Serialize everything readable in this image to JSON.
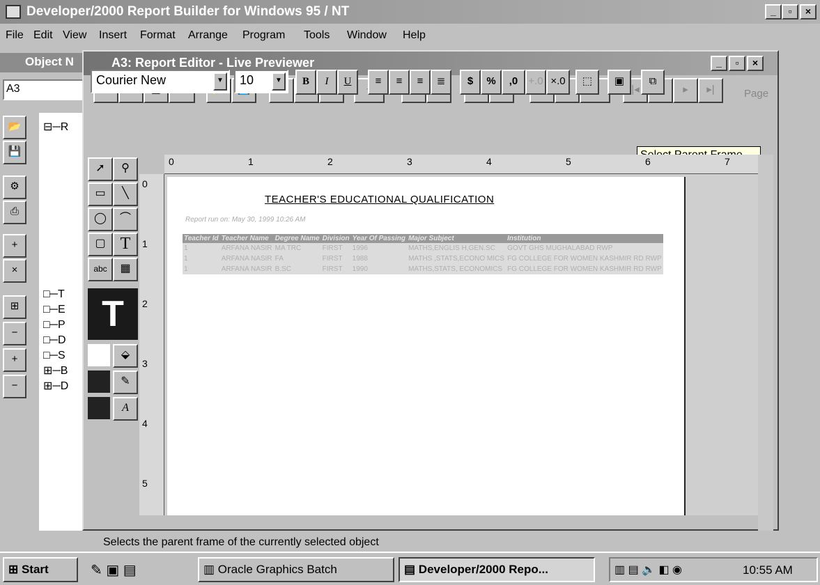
{
  "app": {
    "title": "Developer/2000 Report Builder for Windows 95 / NT",
    "min": "_",
    "max": "▫",
    "close": "×"
  },
  "menu": [
    "File",
    "Edit",
    "View",
    "Insert",
    "Format",
    "Arrange",
    "Program",
    "Tools",
    "Window",
    "Help"
  ],
  "navigator": {
    "title": "Object N",
    "field": "A3",
    "tree_top": "R",
    "tree_items": [
      "T",
      "E",
      "P",
      "D",
      "S",
      "B",
      "D"
    ]
  },
  "editor": {
    "title": "A3: Report Editor - Live Previewer",
    "page_label": "Page"
  },
  "format": {
    "font": "Courier New",
    "size": "10",
    "bold": "B",
    "italic": "I",
    "underline": "U",
    "currency": "$",
    "percent": "%",
    "comma": ",0"
  },
  "tooltip": "Select Parent Frame",
  "ruler": {
    "h": [
      "0",
      "1",
      "2",
      "3",
      "4",
      "5",
      "6",
      "7"
    ],
    "v": [
      "0",
      "1",
      "2",
      "3",
      "4",
      "5"
    ]
  },
  "report": {
    "heading": "TEACHER'S EDUCATIONAL QUALIFICATION",
    "run_on": "Report run on: May 30, 1999 10:26 AM",
    "columns": [
      "Teacher Id",
      "Teacher Name",
      "Degree Name",
      "Division",
      "Year Of Passing",
      "Major Subject",
      "Institution"
    ],
    "rows": [
      [
        "1",
        "ARFANA NASIR",
        "MA TRC",
        "FIRST",
        "1996",
        "MATHS,ENGLIS H,GEN.SC",
        "GOVT GHS MUGHALABAD RWP"
      ],
      [
        "1",
        "ARFANA NASIR",
        "FA",
        "FIRST",
        "1988",
        "MATHS ,STATS,ECONO MICS",
        "FG COLLEGE FOR WOMEN KASHMIR RD RWP"
      ],
      [
        "1",
        "ARFANA NASIR",
        "B.SC",
        "FIRST",
        "1990",
        "MATHS,STATS, ECONOMICS",
        "FG COLLEGE FOR WOMEN KASHMIR RD RWP"
      ]
    ]
  },
  "status": "Selects the parent frame of the currently selected object",
  "taskbar": {
    "start": "Start",
    "tasks": [
      "Oracle Graphics Batch",
      "Developer/2000 Repo..."
    ],
    "clock": "10:55 AM"
  }
}
